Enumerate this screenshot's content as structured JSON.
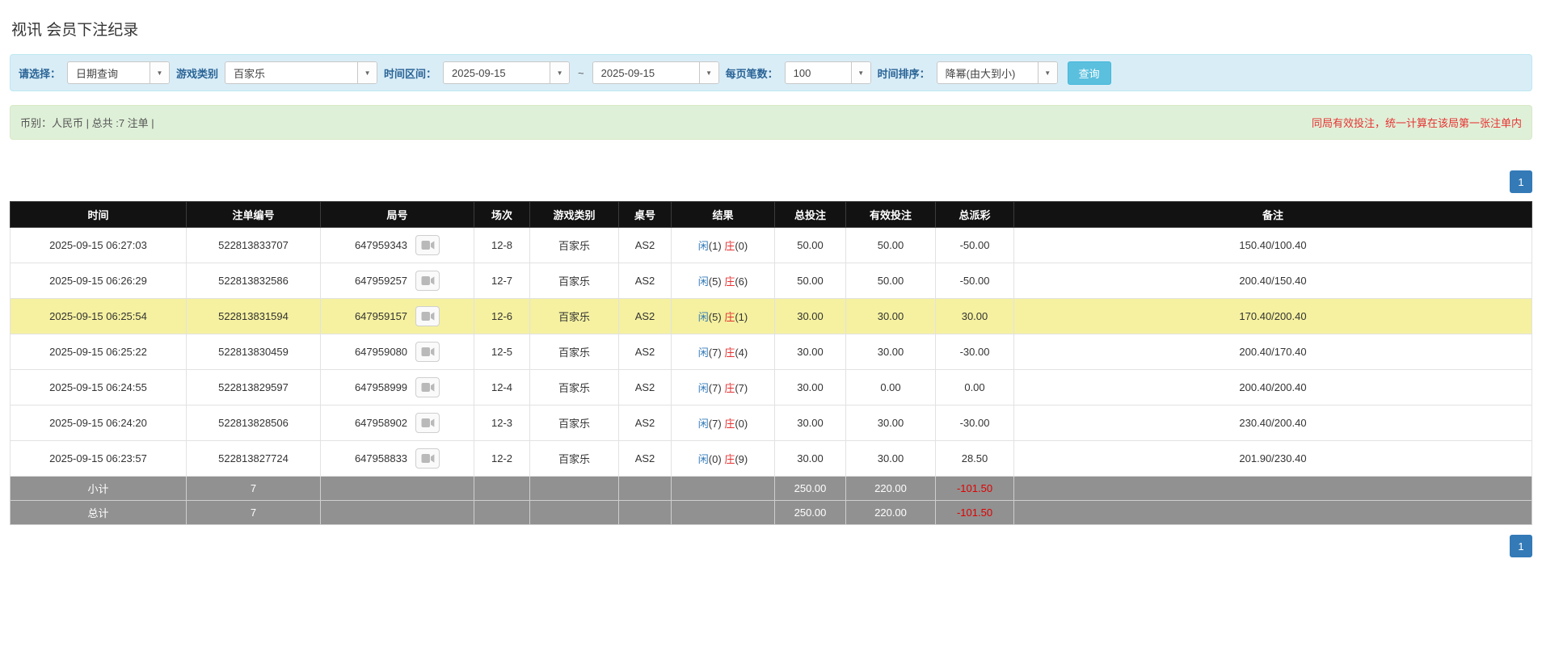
{
  "page": {
    "title": "视讯 会员下注纪录"
  },
  "filters": {
    "query_type": {
      "label": "请选择：",
      "value": "日期查询"
    },
    "game_type": {
      "label": "游戏类别",
      "value": "百家乐"
    },
    "date_range": {
      "label": "时间区间：",
      "from": "2025-09-15",
      "separator": "~",
      "to": "2025-09-15"
    },
    "page_size": {
      "label": "每页笔数：",
      "value": "100"
    },
    "sort": {
      "label": "时间排序：",
      "value": "降幂(由大到小)"
    },
    "search_button": "查询"
  },
  "summary": {
    "currency_info": "币别：人民币 | 总共 :7 注单 |",
    "notice": "同局有效投注，统一计算在该局第一张注单内"
  },
  "pagination": {
    "current_page": "1"
  },
  "colors": {
    "accent_blue": "#337ab7",
    "search_button": "#5bc0de",
    "highlight_row": "#f5f1a0",
    "negative_red": "#e53333",
    "header_black": "#121212",
    "footer_gray": "#919191"
  },
  "table": {
    "headers": [
      "时间",
      "注单编号",
      "局号",
      "场次",
      "游戏类别",
      "桌号",
      "结果",
      "总投注",
      "有效投注",
      "总派彩",
      "备注"
    ],
    "rows": [
      {
        "time": "2025-09-15 06:27:03",
        "bet_id": "522813833707",
        "round_id": "647959343",
        "session": "12-8",
        "game": "百家乐",
        "table_no": "AS2",
        "player": "闲",
        "player_n": "(1)",
        "banker": "庄",
        "banker_n": "(0)",
        "total_bet": "50.00",
        "valid_bet": "50.00",
        "payout": "-50.00",
        "note": "150.40/100.40",
        "highlight": false
      },
      {
        "time": "2025-09-15 06:26:29",
        "bet_id": "522813832586",
        "round_id": "647959257",
        "session": "12-7",
        "game": "百家乐",
        "table_no": "AS2",
        "player": "闲",
        "player_n": "(5)",
        "banker": "庄",
        "banker_n": "(6)",
        "total_bet": "50.00",
        "valid_bet": "50.00",
        "payout": "-50.00",
        "note": "200.40/150.40",
        "highlight": false
      },
      {
        "time": "2025-09-15 06:25:54",
        "bet_id": "522813831594",
        "round_id": "647959157",
        "session": "12-6",
        "game": "百家乐",
        "table_no": "AS2",
        "player": "闲",
        "player_n": "(5)",
        "banker": "庄",
        "banker_n": "(1)",
        "total_bet": "30.00",
        "valid_bet": "30.00",
        "payout": "30.00",
        "note": "170.40/200.40",
        "highlight": true
      },
      {
        "time": "2025-09-15 06:25:22",
        "bet_id": "522813830459",
        "round_id": "647959080",
        "session": "12-5",
        "game": "百家乐",
        "table_no": "AS2",
        "player": "闲",
        "player_n": "(7)",
        "banker": "庄",
        "banker_n": "(4)",
        "total_bet": "30.00",
        "valid_bet": "30.00",
        "payout": "-30.00",
        "note": "200.40/170.40",
        "highlight": false
      },
      {
        "time": "2025-09-15 06:24:55",
        "bet_id": "522813829597",
        "round_id": "647958999",
        "session": "12-4",
        "game": "百家乐",
        "table_no": "AS2",
        "player": "闲",
        "player_n": "(7)",
        "banker": "庄",
        "banker_n": "(7)",
        "total_bet": "30.00",
        "valid_bet": "0.00",
        "payout": "0.00",
        "note": "200.40/200.40",
        "highlight": false
      },
      {
        "time": "2025-09-15 06:24:20",
        "bet_id": "522813828506",
        "round_id": "647958902",
        "session": "12-3",
        "game": "百家乐",
        "table_no": "AS2",
        "player": "闲",
        "player_n": "(7)",
        "banker": "庄",
        "banker_n": "(0)",
        "total_bet": "30.00",
        "valid_bet": "30.00",
        "payout": "-30.00",
        "note": "230.40/200.40",
        "highlight": false
      },
      {
        "time": "2025-09-15 06:23:57",
        "bet_id": "522813827724",
        "round_id": "647958833",
        "session": "12-2",
        "game": "百家乐",
        "table_no": "AS2",
        "player": "闲",
        "player_n": "(0)",
        "banker": "庄",
        "banker_n": "(9)",
        "total_bet": "30.00",
        "valid_bet": "30.00",
        "payout": "28.50",
        "note": "201.90/230.40",
        "highlight": false
      }
    ],
    "subtotal": {
      "label": "小计",
      "count": "7",
      "total_bet": "250.00",
      "valid_bet": "220.00",
      "payout": "-101.50"
    },
    "total": {
      "label": "总计",
      "count": "7",
      "total_bet": "250.00",
      "valid_bet": "220.00",
      "payout": "-101.50"
    }
  }
}
